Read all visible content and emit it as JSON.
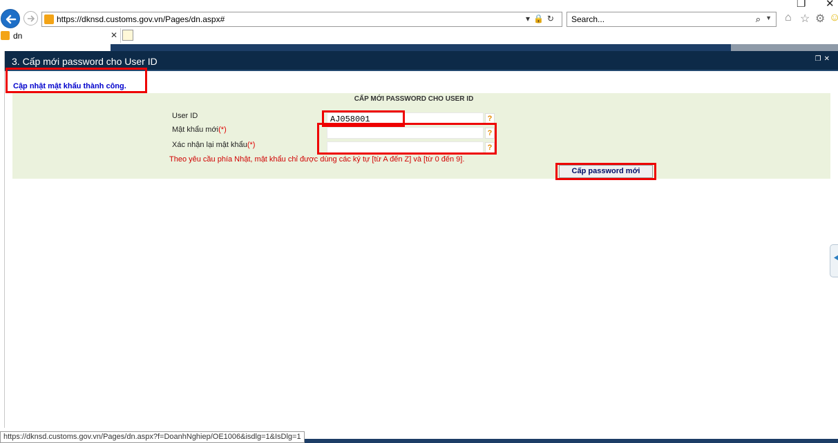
{
  "browser": {
    "url": "https://dknsd.customs.gov.vn/Pages/dn.aspx#",
    "search_placeholder": "Search...",
    "tab_title": "dn",
    "status_url": "https://dknsd.customs.gov.vn/Pages/dn.aspx?f=DoanhNghiep/OE1006&isdlg=1&IsDlg=1"
  },
  "panel": {
    "title": "3. Cấp mới password cho User ID"
  },
  "message": {
    "success": "Cập nhật mật khẩu thành công."
  },
  "form": {
    "title": "CẤP MỚI PASSWORD CHO USER ID",
    "user_id_label": "User ID",
    "user_id_value": "AJ058001",
    "new_password_label": "Mật khẩu mới",
    "confirm_password_label": "Xác nhận lại mật khẩu",
    "required_mark": "(*)",
    "help_mark": "?",
    "note": "Theo yêu cầu phía Nhật, mật khẩu chỉ được dùng các ký tự [từ A đến Z] và [từ 0 đến 9].",
    "submit_label": "Cấp password mới"
  },
  "colors": {
    "header_bg": "#0d2a48",
    "form_bg": "#ebf2dd",
    "success_text": "#0000cc",
    "note_text": "#d00000",
    "annotation": "#ee0000"
  }
}
